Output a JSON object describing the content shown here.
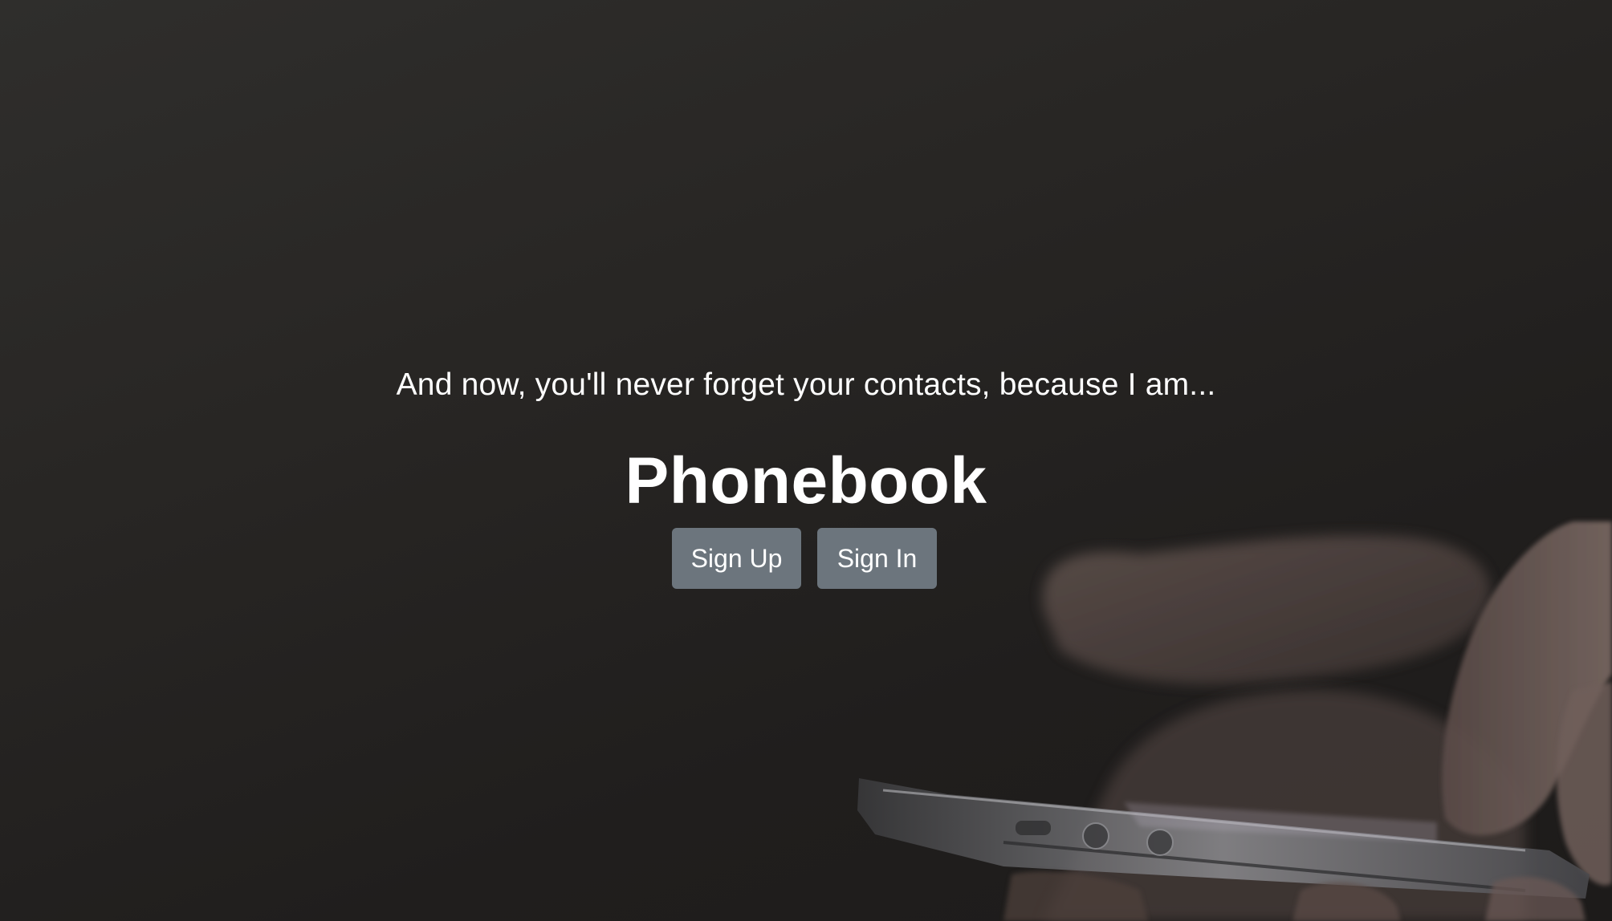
{
  "hero": {
    "tagline": "And now, you'll never forget your contacts, because I am...",
    "title": "Phonebook",
    "background_image": "hand-holding-phone-photo"
  },
  "actions": {
    "sign_up_label": "Sign Up",
    "sign_in_label": "Sign In"
  },
  "colors": {
    "background": "#211f1e",
    "text": "#ffffff",
    "button": "#6c757d"
  }
}
